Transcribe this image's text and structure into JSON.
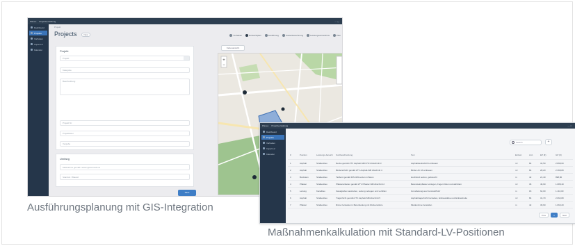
{
  "captions": {
    "left": "Ausführungsplanung mit GIS-Integration",
    "right": "Maßnahmenkalkulation mit Standard-LV-Positionen"
  },
  "shot1": {
    "app_title": "Projektverwaltung",
    "menu_label": "Planeo",
    "breadcrumb": "Projekt",
    "title": "Projects",
    "new_label": "New",
    "legend": [
      "Vorhaben",
      "Entwurfsplan",
      "Ausführung",
      "Kostenberechnung",
      "Leistungsverzeichnis",
      "Plan"
    ],
    "nav": [
      "Dashboard",
      "Projekte",
      "Vorhaben",
      "Import LV",
      "Kalender"
    ],
    "form_section": "Projekt",
    "fields": [
      "Projekt",
      "Kategorie",
      "Beschreibung",
      "Projekt Nr.",
      "Projektleiter",
      "Vergabe"
    ],
    "section2": "Umfang",
    "fields2": [
      "Maßnahme gemäß Leistungsverzeichnis",
      "Standort / Bauteil"
    ],
    "save_label": "Save",
    "map_tab": "Kartenansicht"
  },
  "shot2": {
    "app_title": "Projektverwaltung",
    "menu_label": "Planeo",
    "nav": [
      "Dashboard",
      "Projekte",
      "Vorhaben",
      "Import LV",
      "Kalender"
    ],
    "search_placeholder": "Search",
    "add_label": "+",
    "headers": [
      "#",
      "Position",
      "Leistungs-bereich",
      "Kurzbeschreibung",
      "Text",
      "Einheit",
      "Anz.",
      "EP (€)",
      "GP (€)"
    ],
    "rows": [
      [
        "1",
        "Asphalt",
        "Straßenbau",
        "Decke gemäß ZTV Asphalt-StB 07/13 Abschnitt 3",
        "Asphaltdeckschicht einbauen",
        "m²",
        "84",
        "34,50",
        "2.898,00"
      ],
      [
        "2",
        "Asphalt",
        "Straßenbau",
        "Binderschicht gemäß ZTV Asphalt-StB Abschnitt 4",
        "Binder AC 16 einbauen",
        "m²",
        "84",
        "28,20",
        "2.368,80"
      ],
      [
        "3",
        "Bordstein",
        "Straßenbau",
        "Tiefbord gemäß DIN 483 setzen in Beton",
        "Hochbord setzen, gebraucht",
        "m",
        "42",
        "21,40",
        "898,80"
      ],
      [
        "4",
        "Pflaster",
        "Straßenbau",
        "Pflasterarbeiten gemäß ZTV Pflaster-StB Abschnitt 2",
        "Betonsteinpflaster verlegen, Fugen füllen und abrütteln",
        "m²",
        "36",
        "46,90",
        "1.688,40"
      ],
      [
        "5",
        "Leitung",
        "Kanalbau",
        "Kanalgraben ausheben, Leitung verlegen und verfüllen",
        "Grundleitung aus Kunststoffrohr",
        "m",
        "18",
        "62,00",
        "1.116,00"
      ],
      [
        "6",
        "Asphalt",
        "Straßenbau",
        "Tragschicht gemäß ZTV Asphalt-StB Abschnitt 5",
        "Asphalttragschicht herstellen, Einbaustärke und Einbaubreite",
        "m²",
        "84",
        "31,70",
        "2.662,80"
      ],
      [
        "7",
        "Pflaster",
        "Straßenbau",
        "Rinne herstellen in Betonbettung mit Rückenstütze",
        "Muldenrinne herstellen",
        "m",
        "42",
        "39,60",
        "1.663,20"
      ]
    ],
    "pager": [
      "Prev",
      "1",
      "Next"
    ]
  },
  "colors": {
    "sidebar": "#25364a",
    "accent": "#3a74b9",
    "caption": "#6f7780"
  }
}
